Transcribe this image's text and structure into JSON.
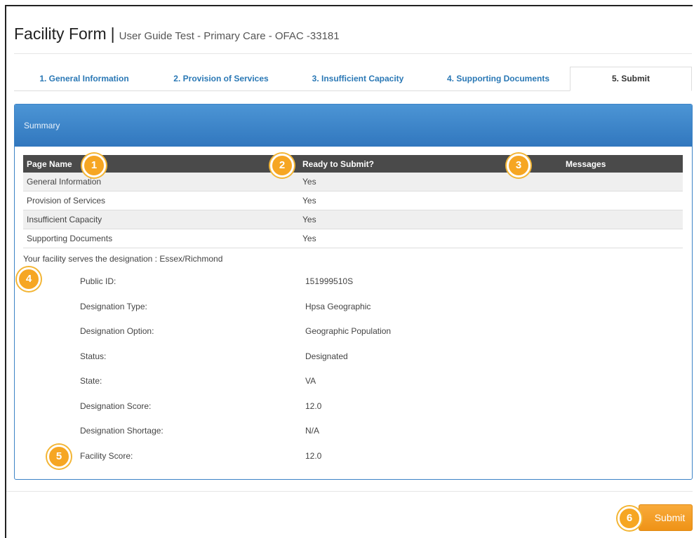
{
  "header": {
    "title": "Facility Form",
    "separator": "|",
    "subtitle": "User Guide Test - Primary Care - OFAC -33181"
  },
  "tabs": [
    {
      "label": "1. General Information",
      "active": false
    },
    {
      "label": "2. Provision of Services",
      "active": false
    },
    {
      "label": "3. Insufficient Capacity",
      "active": false
    },
    {
      "label": "4. Supporting Documents",
      "active": false
    },
    {
      "label": "5. Submit",
      "active": true
    }
  ],
  "panel": {
    "heading": "Summary"
  },
  "summary_table": {
    "columns": [
      "Page Name",
      "Ready to Submit?",
      "Messages"
    ],
    "rows": [
      [
        "General Information",
        "Yes",
        ""
      ],
      [
        "Provision of Services",
        "Yes",
        ""
      ],
      [
        "Insufficient Capacity",
        "Yes",
        ""
      ],
      [
        "Supporting Documents",
        "Yes",
        ""
      ]
    ]
  },
  "designation_note": "Your facility serves the designation : Essex/Richmond",
  "details": [
    {
      "label": "Public ID:",
      "value": "151999510S"
    },
    {
      "label": "Designation Type:",
      "value": "Hpsa Geographic"
    },
    {
      "label": "Designation Option:",
      "value": "Geographic Population"
    },
    {
      "label": "Status:",
      "value": "Designated"
    },
    {
      "label": "State:",
      "value": "VA"
    },
    {
      "label": "Designation Score:",
      "value": "12.0"
    },
    {
      "label": "Designation Shortage:",
      "value": "N/A"
    },
    {
      "label": "Facility Score:",
      "value": "12.0"
    }
  ],
  "callouts": [
    "1",
    "2",
    "3",
    "4",
    "5",
    "6"
  ],
  "footer": {
    "submit_label": "Submit"
  },
  "colors": {
    "panel_header": "#3a86c8",
    "table_header": "#4a4a4a",
    "tab_link": "#2a78b5",
    "callout": "#f6a623",
    "submit": "#f29a1f"
  }
}
